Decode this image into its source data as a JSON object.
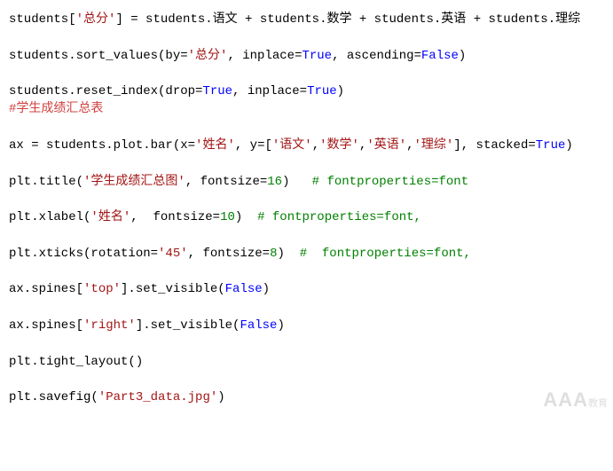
{
  "watermark": "AAA",
  "watermark_sub": "教育",
  "code": {
    "l1": {
      "a": "students[",
      "s1": "'总分'",
      "b": "] = students.语文 + students.数学 + students.英语 + students.理综"
    },
    "l2": {
      "a": "students.sort_values(by=",
      "s1": "'总分'",
      "b": ", inplace=",
      "k1": "True",
      "c": ", ascending=",
      "k2": "False",
      "d": ")"
    },
    "l3": {
      "a": "students.reset_index(drop=",
      "k1": "True",
      "b": ", inplace=",
      "k2": "True",
      "c": ")"
    },
    "l4": {
      "c": "#学生成绩汇总表"
    },
    "l5": {
      "a": "ax = students.plot.bar(x=",
      "s1": "'姓名'",
      "b": ", y=[",
      "s2": "'语文'",
      "c": ",",
      "s3": "'数学'",
      "d": ",",
      "s4": "'英语'",
      "e": ",",
      "s5": "'理综'",
      "f": "], stacked=",
      "k1": "True",
      "g": ")"
    },
    "l6": {
      "a": "plt.title(",
      "s1": "'学生成绩汇总图'",
      "b": ", fontsize=",
      "n1": "16",
      "c": ")   ",
      "cm": "# fontproperties=font"
    },
    "l7": {
      "a": "plt.xlabel(",
      "s1": "'姓名'",
      "b": ",  fontsize=",
      "n1": "10",
      "c": ")  ",
      "cm": "# fontproperties=font,"
    },
    "l8": {
      "a": "plt.xticks(rotation=",
      "s1": "'45'",
      "b": ", fontsize=",
      "n1": "8",
      "c": ")  ",
      "cm": "#  fontproperties=font,"
    },
    "l9": {
      "a": "ax.spines[",
      "s1": "'top'",
      "b": "].set_visible(",
      "k1": "False",
      "c": ")"
    },
    "l10": {
      "a": "ax.spines[",
      "s1": "'right'",
      "b": "].set_visible(",
      "k1": "False",
      "c": ")"
    },
    "l11": {
      "a": "plt.tight_layout()"
    },
    "l12": {
      "a": "plt.savefig(",
      "s1": "'Part3_data.jpg'",
      "b": ")"
    }
  }
}
